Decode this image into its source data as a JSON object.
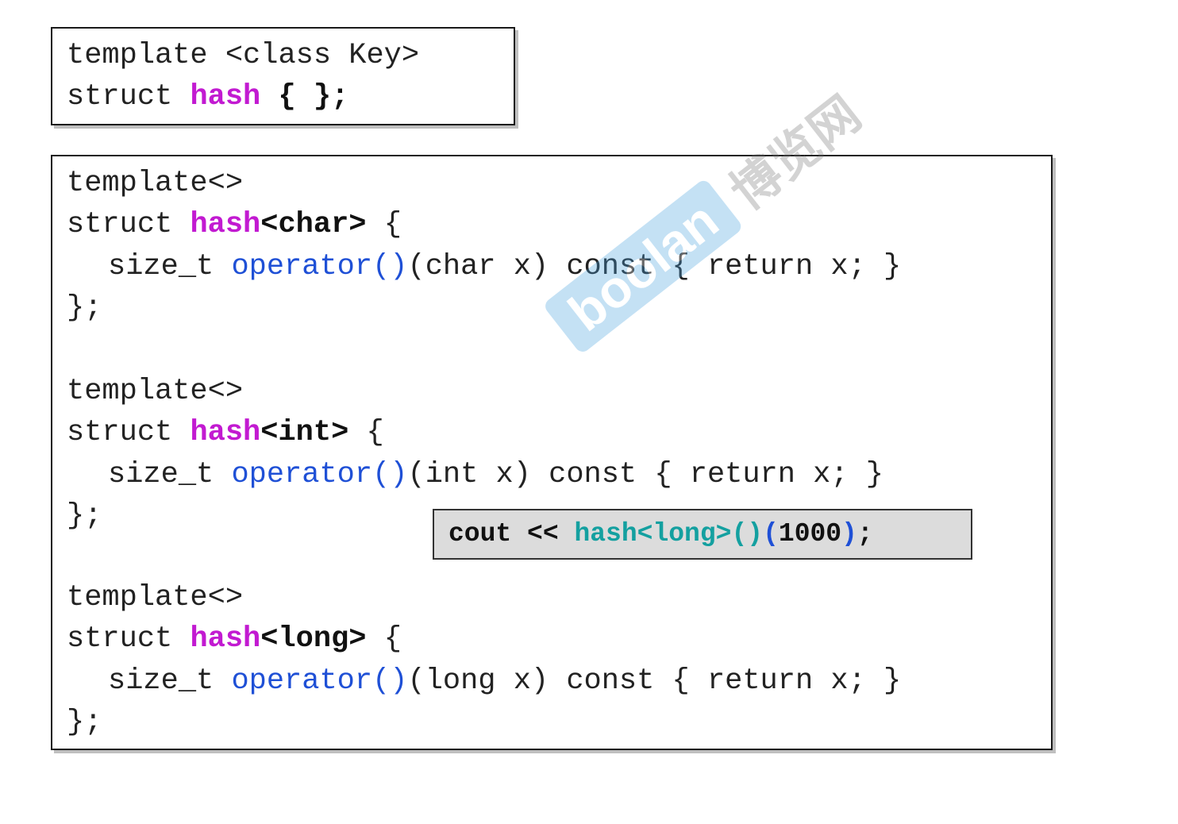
{
  "primary_template": {
    "line1": "template <class Key>",
    "line2_kw": "struct ",
    "line2_name": "hash",
    "line2_rest": " { };"
  },
  "specializations": [
    {
      "header": "template<>",
      "struct_kw": "struct ",
      "name": "hash",
      "type_arg": "<char>",
      "open": " {",
      "body_type": "size_t ",
      "body_op": "operator()",
      "body_rest": "(char x) const { return x; }",
      "close": "};"
    },
    {
      "header": "template<>",
      "struct_kw": "struct ",
      "name": "hash",
      "type_arg": "<int>",
      "open": " {",
      "body_type": "size_t ",
      "body_op": "operator()",
      "body_rest": "(int x) const { return x; }",
      "close": "};"
    },
    {
      "header": "template<>",
      "struct_kw": "struct ",
      "name": "hash",
      "type_arg": "<long>",
      "open": " {",
      "body_type": "size_t ",
      "body_op": "operator()",
      "body_rest": "(long x) const { return x; }",
      "close": "};"
    }
  ],
  "call_example": {
    "prefix": "cout << ",
    "call": "hash<long>()",
    "paren_open": "(",
    "arg": "1000",
    "paren_close": ")",
    "suffix": ";"
  },
  "watermark": {
    "badge": "boolan",
    "chinese": "博览网"
  },
  "colors": {
    "keyword_purple": "#c21ad1",
    "operator_blue": "#1f50d6",
    "call_teal": "#14a0a0"
  }
}
